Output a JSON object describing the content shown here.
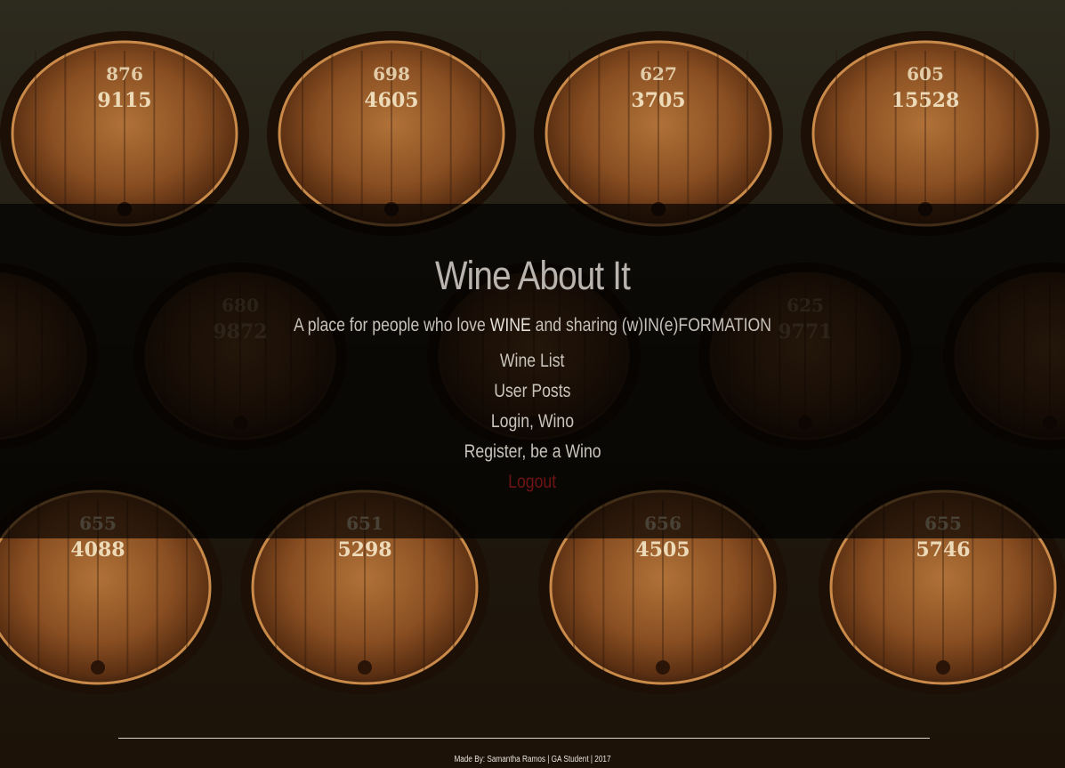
{
  "site": {
    "title": "Wine About It",
    "tagline": {
      "prefix": "A place for people who love ",
      "emphasis_1": "WINE",
      "middle": " and sharing (w)IN(e)FORMATION",
      "emphasis_2": ""
    }
  },
  "nav": {
    "items": [
      {
        "label": "Wine List"
      },
      {
        "label": "User Posts"
      },
      {
        "label": "Login, Wino"
      },
      {
        "label": "Register, be a Wino"
      },
      {
        "label": "Logout"
      }
    ]
  },
  "footer": {
    "credit": "Made By: Samantha Ramos | GA Student | 2017"
  },
  "barrels": {
    "labels": [
      [
        "9115",
        "4605",
        "3705",
        "15528"
      ],
      [
        "9872",
        "9771"
      ],
      [
        "4088",
        "5298",
        "4505",
        "5746"
      ]
    ],
    "top_labels": [
      [
        "876",
        "698",
        "627",
        "605"
      ],
      [
        "680",
        "625"
      ],
      [
        "655",
        "651",
        "656",
        "655"
      ]
    ]
  },
  "colors": {
    "overlay": "#000000",
    "title_text": "#b9b4ae",
    "nav_text": "#c9c4bc",
    "logout_text": "#6e1414",
    "barrel_wood": "#8a4f22"
  }
}
